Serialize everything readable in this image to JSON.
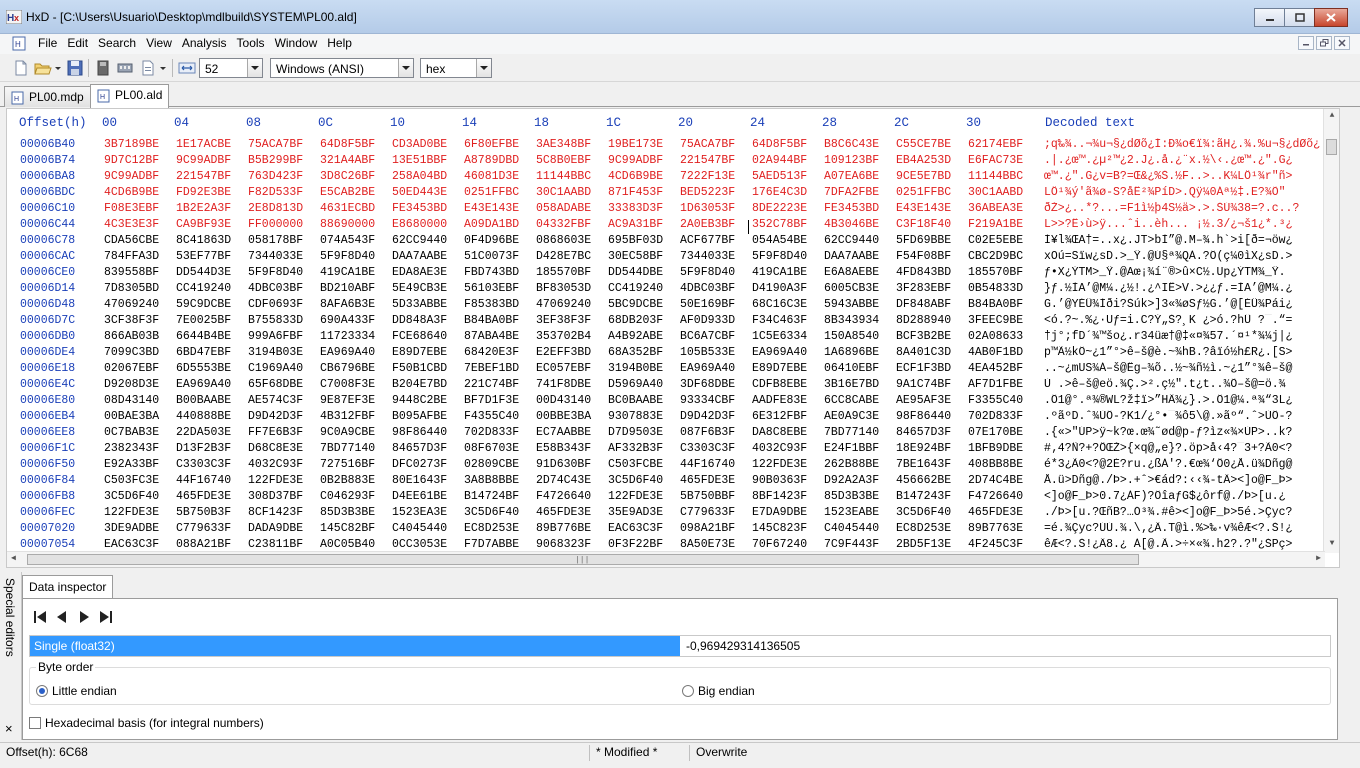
{
  "window": {
    "title": "HxD - [C:\\Users\\Usuario\\Desktop\\mdlbuild\\SYSTEM\\PL00.ald]"
  },
  "menu": [
    "File",
    "Edit",
    "Search",
    "View",
    "Analysis",
    "Tools",
    "Window",
    "Help"
  ],
  "toolbar": {
    "bytes_per_row": "52",
    "charset": "Windows (ANSI)",
    "offset_base": "hex"
  },
  "tabs": [
    {
      "label": "PL00.mdp",
      "active": false
    },
    {
      "label": "PL00.ald",
      "active": true
    }
  ],
  "hex": {
    "header": {
      "offset": "Offset(h)",
      "columns": [
        "00",
        "04",
        "08",
        "0C",
        "10",
        "14",
        "18",
        "1C",
        "20",
        "24",
        "28",
        "2C",
        "30"
      ],
      "decoded": "Decoded text"
    },
    "rows": [
      {
        "offset": "00006B40",
        "modified": true,
        "groups": [
          "3B7189BE",
          "1E17ACBE",
          "75ACA7BF",
          "64D8F5BF",
          "CD3AD0BE",
          "6F80EFBE",
          "3AE348BF",
          "19BE173E",
          "75ACA7BF",
          "64D8F5BF",
          "B8C6C43E",
          "C55CE7BE",
          "62174EBF"
        ],
        "text": ";q‰¾..¬¾u¬§¿dØõ¿Í:Ð¾o€ï¾:ãH¿.¾.%u¬§¿dØõ¿"
      },
      {
        "offset": "00006B74",
        "modified": true,
        "groups": [
          "9D7C12BF",
          "9C99ADBF",
          "B5B299BF",
          "321A4ABF",
          "13E51BBF",
          "A8789DBD",
          "5C8B0EBF",
          "9C99ADBF",
          "221547BF",
          "02A944BF",
          "109123BF",
          "EB4A253D",
          "E6FAC73E"
        ],
        "text": ".|.¿œ™.¿µ²™¿2.J¿.å.¿¨x.½\\‹.¿œ™.¿\".G¿"
      },
      {
        "offset": "00006BA8",
        "modified": true,
        "groups": [
          "9C99ADBF",
          "221547BF",
          "763D423F",
          "3D8C26BF",
          "258A04BD",
          "46081D3E",
          "11144BBC",
          "4CD6B9BE",
          "7222F13E",
          "5AED513F",
          "A07EA6BE",
          "9CE5E7BD",
          "11144BBC"
        ],
        "text": "œ™.¿\".G¿v=B?=Œ&¿%Š.½F..>..K¼LÖ¹¾r\"ñ>"
      },
      {
        "offset": "00006BDC",
        "modified": true,
        "groups": [
          "4CD6B9BE",
          "FD92E3BE",
          "F82D533F",
          "E5CAB2BE",
          "50ED443E",
          "0251FFBC",
          "30C1AABD",
          "871F453F",
          "BED5223F",
          "176E4C3D",
          "7DFA2FBE",
          "0251FFBC",
          "30C1AABD"
        ],
        "text": "LÖ¹¾ý'ã¾ø-S?åÊ²¾PíD>.Qÿ¼0Áª½‡.E?¾Õ\""
      },
      {
        "offset": "00006C10",
        "modified": true,
        "groups": [
          "F08E3EBF",
          "1B2E2A3F",
          "2E8D813D",
          "4631ECBD",
          "FE3453BD",
          "E43E143E",
          "058ADABE",
          "33383D3F",
          "1D63053F",
          "8DE2223E",
          "FE3453BD",
          "E43E143E",
          "36ABEA3E"
        ],
        "text": "ðŽ>¿..*?...=F1ì½þ4S½ä>.>.ŠÚ¾38=?.c..?"
      },
      {
        "offset": "00006C44",
        "modified": true,
        "groups": [
          "4C3E3E3F",
          "CA9BF93E",
          "FF000000",
          "88690000",
          "E8680000",
          "A09DA1BD",
          "04332FBF",
          "AC9A31BF",
          "2A0EB3BF",
          "352C78BF",
          "4B3046BE",
          "C3F18F40",
          "F219A1BE"
        ],
        "text": "L>>?Ê›ù>ÿ...ˆi..èh... ¡½.3/¿¬š1¿*.³¿"
      },
      {
        "offset": "00006C78",
        "modified": false,
        "groups": [
          "CDA56CBE",
          "8C41863D",
          "058178BF",
          "074A543F",
          "62CC9440",
          "0F4D96BE",
          "0868603E",
          "695BF03D",
          "ACF677BF",
          "054A54BE",
          "62CC9440",
          "5FD69BBE",
          "C02E5EBE"
        ],
        "text": "Í¥l¾ŒA†=..x¿.JT>bÌ”@.M–¾.h`>i[ð=¬öw¿"
      },
      {
        "offset": "00006CAC",
        "modified": false,
        "groups": [
          "784FFA3D",
          "53EF77BF",
          "7344033E",
          "5F9F8D40",
          "DAA7AABE",
          "51C0073F",
          "D428E7BC",
          "30EC58BF",
          "7344033E",
          "5F9F8D40",
          "DAA7AABE",
          "F54F08BF",
          "CBC2D9BC"
        ],
        "text": "xOú=Sïw¿sD.>_Ÿ.@Ú§ª¾QÀ.?Ô(ç¼0ìX¿sD.>"
      },
      {
        "offset": "00006CE0",
        "modified": false,
        "groups": [
          "839558BF",
          "DD544D3E",
          "5F9F8D40",
          "419CA1BE",
          "EDA8AE3E",
          "FBD743BD",
          "185570BF",
          "DD544DBE",
          "5F9F8D40",
          "419CA1BE",
          "E6A8AEBE",
          "4FD843BD",
          "185570BF"
        ],
        "text": "ƒ•X¿ÝTM>_Ÿ.@Aœ¡¾í¨®>û×C½.Up¿ÝTM¾_Ÿ."
      },
      {
        "offset": "00006D14",
        "modified": false,
        "groups": [
          "7D8305BD",
          "CC419240",
          "4DBC03BF",
          "BD210ABF",
          "5E49CB3E",
          "56103EBF",
          "BF83053D",
          "CC419240",
          "4DBC03BF",
          "D4190A3F",
          "6005CB3E",
          "3F283EBF",
          "0B54833D"
        ],
        "text": "}ƒ.½ÌA’@M¼.¿½!.¿^IË>V.>¿¿ƒ.=ÌA’@M¼.¿"
      },
      {
        "offset": "00006D48",
        "modified": false,
        "groups": [
          "47069240",
          "59C9DCBE",
          "CDF0693F",
          "8AFA6B3E",
          "5D33ABBE",
          "F85383BD",
          "47069240",
          "5BC9DCBE",
          "50E169BF",
          "68C16C3E",
          "5943ABBE",
          "DF848ABF",
          "B84BA0BF"
        ],
        "text": "G.’@YÉÜ¾Íði?Šúk>]3«¾øSƒ½G.’@[ÉÜ¾Pái¿"
      },
      {
        "offset": "00006D7C",
        "modified": false,
        "groups": [
          "3CF38F3F",
          "7E0025BF",
          "B755833D",
          "690A433F",
          "DD848A3F",
          "B84BA0BF",
          "3EF38F3F",
          "68DB203F",
          "AF0D933D",
          "F34C463F",
          "8B343934",
          "8D288940",
          "3FEEC9BE"
        ],
        "text": "<ó.?~.%¿·Uƒ=i.C?Ý„Š?¸K ¿>ó.?hÛ ?¯.“="
      },
      {
        "offset": "00006DB0",
        "modified": false,
        "groups": [
          "866AB03B",
          "6644B4BE",
          "999A6FBF",
          "11723334",
          "FCE68640",
          "87ABA4BE",
          "353702B4",
          "A4B92ABE",
          "BC6A7CBF",
          "1C5E6334",
          "150A8540",
          "BCF3B2BE",
          "02A08633"
        ],
        "text": "†j°;fD´¾™šo¿.r34üæ†@‡«¤¾57.´¤¹*¾¼j|¿"
      },
      {
        "offset": "00006DE4",
        "modified": false,
        "groups": [
          "7099C3BD",
          "6BD47EBF",
          "3194B03E",
          "EA969A40",
          "E89D7EBE",
          "68420E3F",
          "E2EFF3BD",
          "68A352BF",
          "105B533E",
          "EA969A40",
          "1A6896BE",
          "8A401C3D",
          "4AB0F1BD"
        ],
        "text": "p™Ã½kÔ~¿1”°>ê–š@è.~¾hB.?âïó½h£R¿.[S>"
      },
      {
        "offset": "00006E18",
        "modified": false,
        "groups": [
          "02067EBF",
          "6D5553BE",
          "C1969A40",
          "CB6796BE",
          "F50B1CBD",
          "7EBEF1BD",
          "EC057EBF",
          "3194B0BE",
          "EA969A40",
          "E89D7EBE",
          "06410EBF",
          "ECF1F3BD",
          "4EA452BF"
        ],
        "text": "..~¿mUS¾Á–š@Ëg–¾õ..½~¾ñ½ì.~¿1”°¾ê–š@"
      },
      {
        "offset": "00006E4C",
        "modified": false,
        "groups": [
          "D9208D3E",
          "EA969A40",
          "65F68DBE",
          "C7008F3E",
          "B204E7BD",
          "221C74BF",
          "741F8DBE",
          "D5969A40",
          "3DF68DBE",
          "CDFB8EBE",
          "3B16E7BD",
          "9A1C74BF",
          "AF7D1FBE"
        ],
        "text": "Ù .>ê–š@eö.¾Ç.>².ç½\".t¿t..¾Õ–š@=ö.¾"
      },
      {
        "offset": "00006E80",
        "modified": false,
        "groups": [
          "08D43140",
          "B00BAABE",
          "AE574C3F",
          "9E87EF3E",
          "9448C2BE",
          "BF7D1F3E",
          "00D43140",
          "BC0BAABE",
          "93334CBF",
          "AADFE83E",
          "6CC8CABE",
          "AE95AF3E",
          "F3355C40"
        ],
        "text": ".Ô1@°.ª¾®WL?ž‡ï>”HÂ¾¿}.>.Ô1@¼.ª¾“3L¿"
      },
      {
        "offset": "00006EB4",
        "modified": false,
        "groups": [
          "00BAE3BA",
          "440888BE",
          "D9D42D3F",
          "4B312FBF",
          "B095AFBE",
          "F4355C40",
          "00BBE3BA",
          "9307883E",
          "D9D42D3F",
          "6E312FBF",
          "AE0A9C3E",
          "98F86440",
          "702D833F"
        ],
        "text": ".ºãºD.ˆ¾ÙÔ-?K1/¿°•¯¾ô5\\@.»ãº“.ˆ>ÙÔ-?"
      },
      {
        "offset": "00006EE8",
        "modified": false,
        "groups": [
          "0C7BAB3E",
          "22DA503E",
          "FF7E6B3F",
          "9C0A9CBE",
          "98F86440",
          "702D833F",
          "EC7AABBE",
          "D7D9503E",
          "087F6B3F",
          "DA8C8EBE",
          "7BD77140",
          "84657D3F",
          "07E170BE"
        ],
        "text": ".{«>\"ÚP>ÿ~k?œ.œ¾˜ød@p-ƒ?ìz«¾×ÙP>..k?"
      },
      {
        "offset": "00006F1C",
        "modified": false,
        "groups": [
          "2382343F",
          "D13F2B3F",
          "D68C8E3E",
          "7BD77140",
          "84657D3F",
          "08F6703E",
          "E58B343F",
          "AF332B3F",
          "C3303C3F",
          "4032C93F",
          "E24F1BBF",
          "18E924BF",
          "1BFB9DBE"
        ],
        "text": "#‚4?Ñ?+?ÖŒŽ>{×q@„e}?.öp>å‹4?¯3+?Ã0<?"
      },
      {
        "offset": "00006F50",
        "modified": false,
        "groups": [
          "E92A33BF",
          "C3303C3F",
          "4032C93F",
          "727516BF",
          "DFC0273F",
          "02809CBE",
          "91D630BF",
          "C503FCBE",
          "44F16740",
          "122FDE3E",
          "262B88BE",
          "7BE1643F",
          "408BB8BE"
        ],
        "text": "é*3¿Ã0<?@2É?ru.¿ßÀ'?.€œ¾‘Ö0¿Å.ü¾Dñg@"
      },
      {
        "offset": "00006F84",
        "modified": false,
        "groups": [
          "C503FC3E",
          "44F16740",
          "122FDE3E",
          "0B2B883E",
          "80E1643F",
          "3A8B8BBE",
          "2D74C43E",
          "3C5D6F40",
          "465FDE3E",
          "90B0363F",
          "D92A2A3F",
          "456662BE",
          "2D74C4BE"
        ],
        "text": "Å.ü>Dñg@./Þ>.+ˆ>€ád?:‹‹¾-tÄ><]o@F_Þ>"
      },
      {
        "offset": "00006FB8",
        "modified": false,
        "groups": [
          "3C5D6F40",
          "465FDE3E",
          "308D37BF",
          "C046293F",
          "D4EE61BE",
          "B14724BF",
          "F4726640",
          "122FDE3E",
          "5B750BBF",
          "8BF1423F",
          "85D3B3BE",
          "B147243F",
          "F4726640"
        ],
        "text": "<]o@F_Þ>0.7¿ÀF)?ÔîaƒG$¿ôrf@./Þ>[u.¿"
      },
      {
        "offset": "00006FEC",
        "modified": false,
        "groups": [
          "122FDE3E",
          "5B750B3F",
          "8CF1423F",
          "85D3B3BE",
          "1523EA3E",
          "3C5D6F40",
          "465FDE3E",
          "35E9AD3E",
          "C779633F",
          "E7DA9DBE",
          "1523EABE",
          "3C5D6F40",
          "465FDE3E"
        ],
        "text": "./Þ>[u.?ŒñB?…Ó³¾.#ê><]o@F_Þ>5é.>Çyc?"
      },
      {
        "offset": "00007020",
        "modified": false,
        "groups": [
          "3DE9ADBE",
          "C779633F",
          "DADA9DBE",
          "145C82BF",
          "C4045440",
          "EC8D253E",
          "89B776BE",
          "EAC63C3F",
          "098A21BF",
          "145C823F",
          "C4045440",
          "EC8D253E",
          "89B7763E"
        ],
        "text": "=é.¾Çyc?ÚÚ.¾.\\‚¿Ä.T@ì.%>‰·v¾êÆ<?.Š!¿"
      },
      {
        "offset": "00007054",
        "modified": false,
        "groups": [
          "EAC63C3F",
          "088A21BF",
          "C23811BF",
          "A0C05B40",
          "0CC3053E",
          "F7D7ABBE",
          "9068323F",
          "0F3F22BF",
          "8A50E73E",
          "70F67240",
          "7C9F443F",
          "2BD5F13E",
          "4F245C3F"
        ],
        "text": "êÆ<?.Š!¿Â8.¿ À[@.Ã.>÷×«¾.h2?.?\"¿ŠPç>"
      }
    ]
  },
  "inspector": {
    "side_label": "Special editors",
    "close": "×",
    "tab": "Data inspector",
    "data_type": "Single (float32)",
    "data_value": "-0,969429314136505",
    "byte_order_legend": "Byte order",
    "little_endian": "Little endian",
    "big_endian": "Big endian",
    "byte_order_selected": "little",
    "hex_basis": "Hexadecimal basis (for integral numbers)"
  },
  "status": {
    "offset": "Offset(h): 6C68",
    "modified": "* Modified *",
    "mode": "Overwrite"
  },
  "colors": {
    "offset_blue": "#1a3fb8",
    "modified_red": "#e02020",
    "selection_blue": "#3399ff"
  }
}
